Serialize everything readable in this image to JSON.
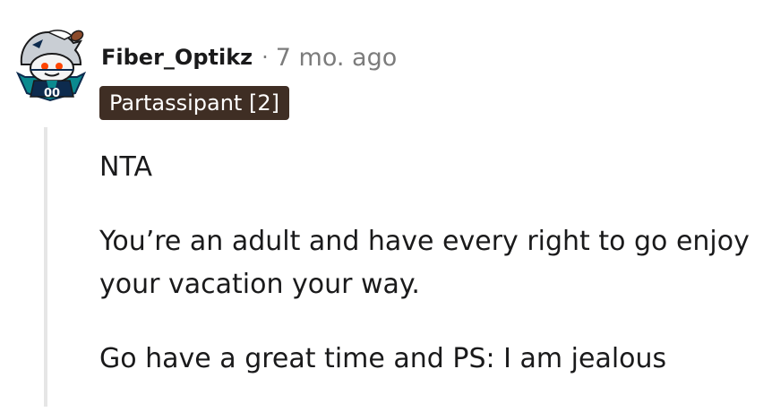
{
  "comment": {
    "author": "Fiber_Optikz",
    "separator": "·",
    "time_ago": "7 mo. ago",
    "flair": "Partassipant [2]",
    "paragraphs": [
      "NTA",
      "You’re an adult and have every right to go enjoy your vacation your way.",
      "Go have a great time and PS: I am jealous"
    ]
  },
  "avatar": {
    "icon": "snoo-football-helmet-avatar-icon",
    "helmet_number": "00",
    "colors": {
      "teal": "#0b8a8f",
      "navy": "#0d2b4e",
      "silver": "#c9ced4",
      "snoo_face": "#f4f4f4",
      "eye_red": "#ff4500",
      "football": "#8b4a2b"
    }
  },
  "colors": {
    "text": "#1a1a1b",
    "meta": "#7c7c7c",
    "flair_bg": "#3f2e24",
    "flair_text": "#ffffff",
    "thread_line": "#e6e6e6"
  }
}
